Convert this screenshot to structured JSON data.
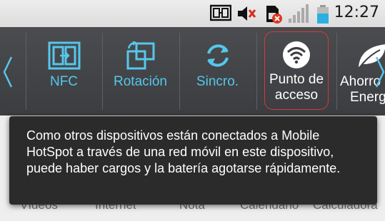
{
  "status_bar": {
    "time": "12:27",
    "icons": [
      "nfc-status-icon",
      "mute-icon",
      "no-sim-icon",
      "signal-icon",
      "battery-icon"
    ],
    "battery_color": "#2ab0e0"
  },
  "quick_settings": {
    "tiles": [
      {
        "id": "nfc",
        "label": "NFC",
        "icon": "nfc-icon"
      },
      {
        "id": "rotation",
        "label": "Rotación",
        "icon": "rotation-icon"
      },
      {
        "id": "sync",
        "label": "Sincro.",
        "icon": "sync-icon"
      },
      {
        "id": "hotspot",
        "label_line1": "Punto de",
        "label_line2": "acceso",
        "icon": "wifi-hotspot-icon"
      },
      {
        "id": "power_saver",
        "label_line1": "Ahorro",
        "label_line2": "Energ",
        "icon": "leaf-icon"
      }
    ],
    "accent_color": "#56c7ec"
  },
  "apps": [
    "Vídeos",
    "Internet",
    "Nota",
    "Calendario",
    "Calculadora"
  ],
  "tooltip": {
    "text": "Como otros dispositivos están conectados a Mobile HotSpot a través de una red móvil en este dispositivo,  puede haber cargos y la batería agotarse rápidamente."
  }
}
